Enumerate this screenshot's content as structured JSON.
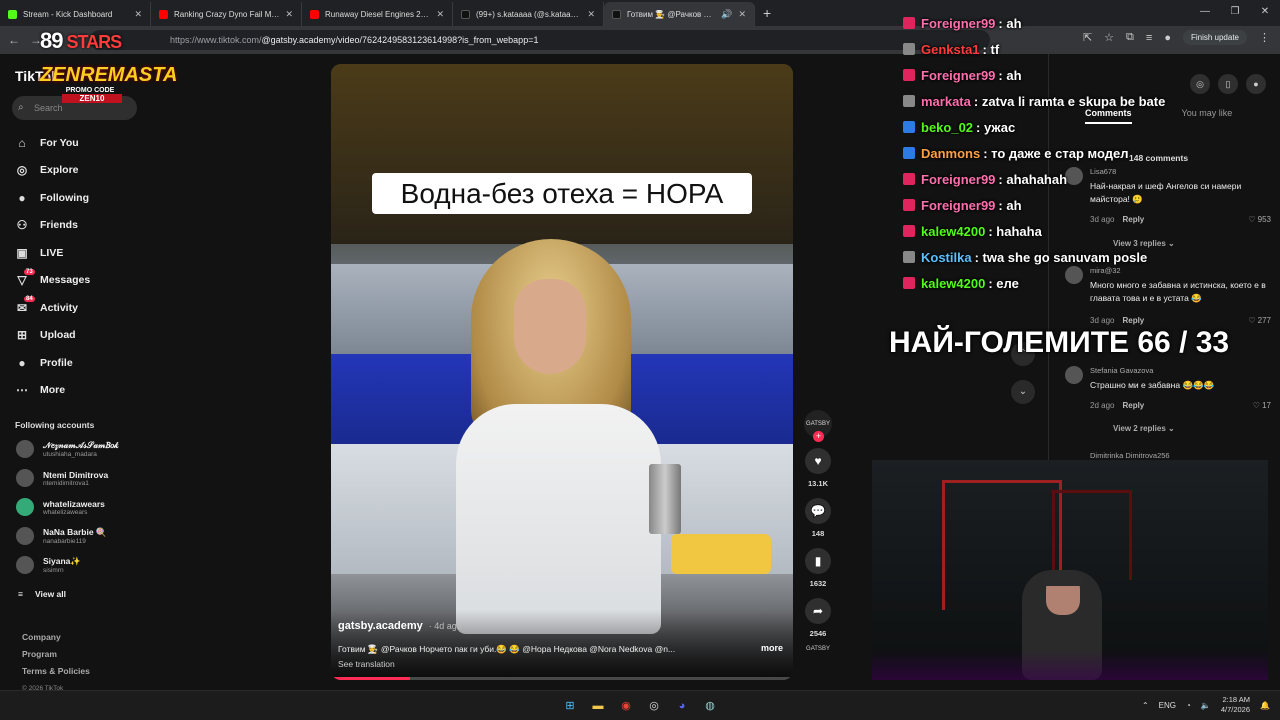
{
  "tabs": [
    {
      "title": "Stream - Kick Dashboard",
      "color": "#53fc18"
    },
    {
      "title": "Ranking Crazy Dyno Fail Mome",
      "color": "#ff0000"
    },
    {
      "title": "Runaway Diesel Engines 2022 -",
      "color": "#ff0000"
    },
    {
      "title": "(99+) s.kataaaa (@s.kataaaa)'s v",
      "color": "#000000"
    },
    {
      "title": "Готвим 👨‍🍳 @Рачков Нор",
      "color": "#000000"
    }
  ],
  "browser": {
    "url_prefix": "https://www.tiktok.com/",
    "url_path": "@gatsby.academy/video/7624249583123614998?is_from_webapp=1",
    "finish_update": "Finish update"
  },
  "brand": {
    "num": "89",
    "stars": "STARS",
    "name": "ZENREMASTA",
    "promo": "PROMO CODE",
    "code": "ZEN10"
  },
  "sidebar": {
    "logo": "TikTok",
    "search_placeholder": "Search",
    "nav": [
      {
        "label": "For You",
        "icon": "⌂"
      },
      {
        "label": "Explore",
        "icon": "◎"
      },
      {
        "label": "Following",
        "icon": "●"
      },
      {
        "label": "Friends",
        "icon": "⚇"
      },
      {
        "label": "LIVE",
        "icon": "▣"
      },
      {
        "label": "Messages",
        "icon": "▽",
        "badge": "73"
      },
      {
        "label": "Activity",
        "icon": "✉",
        "badge": "84"
      },
      {
        "label": "Upload",
        "icon": "⊞"
      },
      {
        "label": "Profile",
        "icon": "●"
      },
      {
        "label": "More",
        "icon": "⋯"
      }
    ],
    "following_title": "Following accounts",
    "accounts": [
      {
        "name": "𝒩𝑒𝓏𝓃𝒶𝓂𝒜𝓈𝒮𝒶𝓂𝐵𝑜𝓀",
        "handle": "utushiaha_madara"
      },
      {
        "name": "Ntemi Dimitrova",
        "handle": "ntemidimitrova1"
      },
      {
        "name": "whatelizawears",
        "handle": "whatelizawears"
      },
      {
        "name": "NaNa Barbie 🍭",
        "handle": "nanabarbie119"
      },
      {
        "name": "Siyana✨",
        "handle": "sisimrn"
      }
    ],
    "view_all": "View all",
    "footer": [
      "Company",
      "Program",
      "Terms & Policies"
    ],
    "copyright": "© 2026 TikTok"
  },
  "video": {
    "caption": "Водна-без отеха = НОРА",
    "username": "gatsby.academy",
    "age": "· 4d ago",
    "description": "Готвим 👨‍🍳 @Рачков Норчето пак ги уби.😂 😂 @Нора Недкова @Nora Nedkova @n...",
    "more": "more",
    "see_translation": "See translation",
    "progress": 0.17
  },
  "actions": {
    "avatar_text": "GATSBY",
    "likes": "13.1K",
    "comments": "148",
    "saves": "1632",
    "shares": "2546"
  },
  "comments_panel": {
    "tab_comments": "Comments",
    "tab_like": "You may like",
    "count": "148 comments",
    "items": [
      {
        "user": "Lisa678",
        "text": "Най-накрая и шеф Ангелов си намери майстора! 🥲",
        "date": "3d ago",
        "likes": "953"
      },
      {
        "user": "mira@32",
        "text": "Много много е забавна и истинска, което е в главата това и е в устата 😂",
        "date": "3d ago",
        "likes": "277"
      },
      {
        "user": "Stefania Gavazova",
        "text": "Страшно ми е забавна 😂😂😂",
        "date": "2d ago",
        "likes": "17"
      }
    ],
    "reply": "Reply",
    "view_replies_1": "View 3 replies",
    "view_replies_2": "View 2 replies",
    "partial_user": "Dimitrinka Dimitrova256"
  },
  "chat": [
    {
      "user": "Foreigner99",
      "msg": ": ah",
      "color": "#ff6fae",
      "badge": "#e0245e"
    },
    {
      "user": "Genksta1",
      "msg": ": tf",
      "color": "#ff3b3b",
      "badge": "#888888"
    },
    {
      "user": "Foreigner99",
      "msg": ": ah",
      "color": "#ff6fae",
      "badge": "#e0245e"
    },
    {
      "user": "markata",
      "msg": ": zatva li ramta e skupa be bate",
      "color": "#ff6fae",
      "badge": "#888888"
    },
    {
      "user": "beko_02",
      "msg": ": ужас",
      "color": "#53fc18",
      "badge": "#2d7be5"
    },
    {
      "user": "Danmons",
      "msg": ": то даже е стар модел",
      "color": "#ff9f43",
      "badge": "#2d7be5"
    },
    {
      "user": "Foreigner99",
      "msg": ": ahahahah",
      "color": "#ff6fae",
      "badge": "#e0245e"
    },
    {
      "user": "Foreigner99",
      "msg": ": ah",
      "color": "#ff6fae",
      "badge": "#e0245e"
    },
    {
      "user": "kalew4200",
      "msg": ": hahaha",
      "color": "#53fc18",
      "badge": "#e0245e"
    },
    {
      "user": "Kostilka",
      "msg": ": twa she go sanuvam posle",
      "color": "#5bc0ff",
      "badge": "#888888"
    },
    {
      "user": "kalew4200",
      "msg": ": еле",
      "color": "#53fc18",
      "badge": "#e0245e"
    }
  ],
  "overlay_title": "НАЙ-ГОЛЕМИТЕ 66 / 33",
  "taskbar": {
    "lang": "ENG",
    "time": "2:18 AM",
    "date": "4/7/2026"
  }
}
